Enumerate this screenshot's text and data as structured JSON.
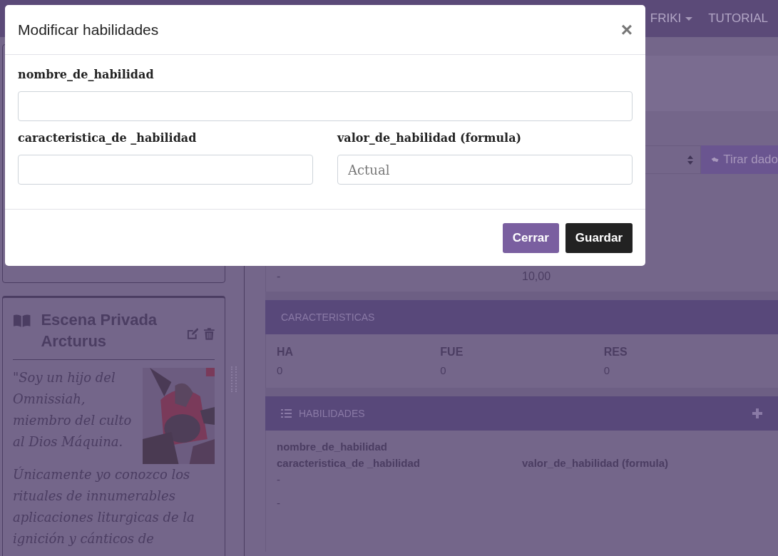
{
  "navbar": {
    "items": [
      {
        "label": "FRIKI",
        "dropdown": true
      },
      {
        "label": "TUTORIAL",
        "dropdown": false
      }
    ]
  },
  "scene_card": {
    "title": "Escena Privada Arcturus",
    "quote": [
      "\"Soy un hijo del Omnissiah, miembro del culto al Dios Máquina.",
      "Únicamente yo conozco los rituales de innumerables aplicaciones liturgicas de la ignición y cánticos de"
    ]
  },
  "dice": {
    "button": "Tirar dado"
  },
  "summary": {
    "column_1": "-",
    "column_2": "10,00"
  },
  "characteristics": {
    "title": "CARACTERISTICAS",
    "stats": [
      {
        "name": "HA",
        "value": "0"
      },
      {
        "name": "FUE",
        "value": "0"
      },
      {
        "name": "RES",
        "value": "0"
      }
    ]
  },
  "skills": {
    "title": "HABILIDADES",
    "name_label": "nombre_de_habilidad",
    "characteristic_label": "caracteristica_de _habilidad",
    "value_label": "valor_de_habilidad (formula)",
    "values": [
      "-",
      "-"
    ]
  },
  "modal": {
    "title": "Modificar habilidades",
    "close": "×",
    "rows": [
      [
        {
          "label": "nombre_de_habilidad"
        }
      ],
      [
        {
          "label": "caracteristica_de _habilidad"
        },
        {
          "label": "valor_de_habilidad (formula)",
          "placeholder": "Actual"
        }
      ]
    ],
    "buttons": [
      {
        "label": "Cerrar",
        "kind": "secondary"
      },
      {
        "label": "Guardar",
        "kind": "primary"
      }
    ]
  }
}
